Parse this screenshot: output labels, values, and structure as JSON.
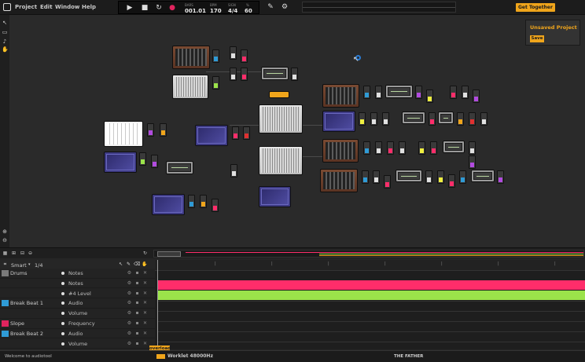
{
  "menu": {
    "project": "Project",
    "edit": "Edit",
    "window": "Window",
    "help": "Help"
  },
  "transport": {
    "bars_label": "BARS",
    "bars_value": "001.01",
    "bpm_label": "BPM",
    "bpm_value": "170",
    "sign_label": "SIGN",
    "sign_value": "4/4",
    "zoom_label": "%",
    "zoom_value": "60"
  },
  "header_button": "Get Together",
  "project_panel": {
    "title": "Unsaved Project",
    "save_label": "Save"
  },
  "track_header": {
    "snap_label": "Smart",
    "snap_value": "1/4"
  },
  "tracks": [
    {
      "label": "Drums",
      "param": "Notes",
      "icon_color": "#7a7a7a"
    },
    {
      "label": "",
      "param": "Notes",
      "icon_color": ""
    },
    {
      "label": "",
      "param": "#4 Level",
      "icon_color": ""
    },
    {
      "label": "Break Beat 1",
      "param": "Audio",
      "icon_color": "#2f9bd6"
    },
    {
      "label": "",
      "param": "Volume",
      "icon_color": ""
    },
    {
      "label": "Slope",
      "param": "Frequency",
      "icon_color": "#e0245e"
    },
    {
      "label": "Break Beat 2",
      "param": "Audio",
      "icon_color": "#2f9bd6"
    },
    {
      "label": "",
      "param": "Volume",
      "icon_color": ""
    }
  ],
  "status": {
    "message": "Welcome to audiotool",
    "worklet": "Worklet 48000Hz",
    "song": "THE FATHER",
    "overload": "overload"
  },
  "colors": {
    "accent": "#f0a51b",
    "lane_pink": "#ff2d6a",
    "lane_green": "#9be34a",
    "blue_icon": "#2f9bd6"
  }
}
